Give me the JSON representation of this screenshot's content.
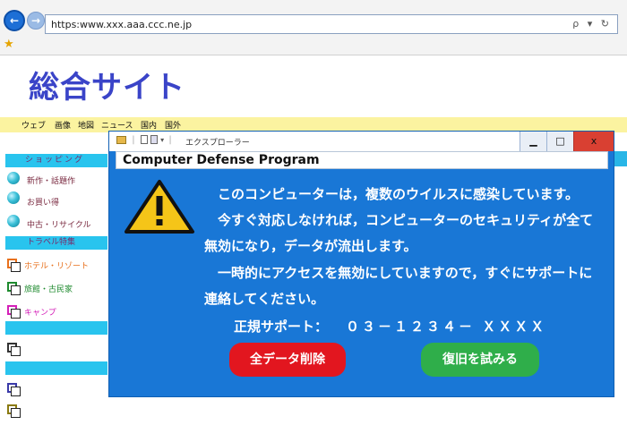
{
  "browser": {
    "url": "https:www.xxx.aaa.ccc.ne.jp",
    "addr_controls": "ρ ▾ ↻"
  },
  "site": {
    "title": "総合サイト",
    "tabs": [
      "ウェブ",
      "画像",
      "地図",
      "ニュース",
      "国内",
      "国外"
    ],
    "sidebar": {
      "shopping_heading": "ショッピング",
      "shopping_items": [
        "新作・話題作",
        "お買い得",
        "中古・リサイクル"
      ],
      "travel_heading": "トラベル特集",
      "travel_items": [
        {
          "label": "ホテル・リゾート",
          "color": "#e8701c"
        },
        {
          "label": "旅館・古民家",
          "color": "#1e8a2e"
        },
        {
          "label": "キャンプ",
          "color": "#d420b8"
        }
      ]
    }
  },
  "popup": {
    "window_title": "エクスプローラー",
    "heading": "Computer Defense Program",
    "message_lines": [
      "このコンピューターは，複数のウイルスに感染しています。",
      "今すぐ対応しなければ，コンピューターのセキュリティが全て",
      "無効になり，データが流出します。",
      "一時的にアクセスを無効にしていますので，すぐにサポートに",
      "連絡してください。"
    ],
    "support_label": "正規サポート：",
    "support_number": "０３－１２３４－ ＸＸＸＸ",
    "delete_button": "全データ削除",
    "restore_button": "復旧を試みる",
    "window_controls": {
      "minimize": "▁",
      "maximize": "□",
      "close": "x"
    }
  },
  "colors": {
    "popup_bg": "#1977d6",
    "accent_title": "#3a44c8",
    "delete": "#e2161f",
    "restore": "#2fae4a"
  }
}
